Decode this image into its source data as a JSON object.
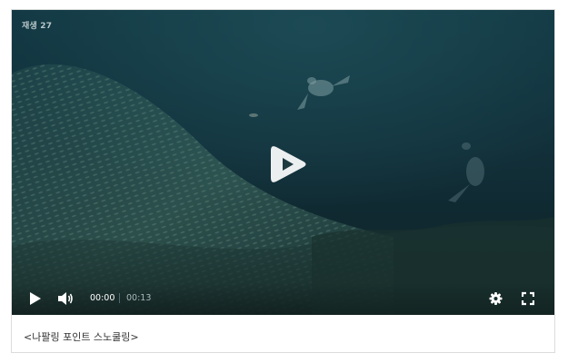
{
  "player": {
    "view_count_label": "재생 27",
    "current_time": "00:00",
    "duration": "00:13",
    "accent_color": "#ffffff",
    "icons": {
      "big_play": "play-circle-icon",
      "play": "play-icon",
      "volume": "volume-icon",
      "settings": "gear-icon",
      "fullscreen": "fullscreen-icon"
    }
  },
  "caption": {
    "text": "<나팔링 포인트 스노쿨링>"
  }
}
